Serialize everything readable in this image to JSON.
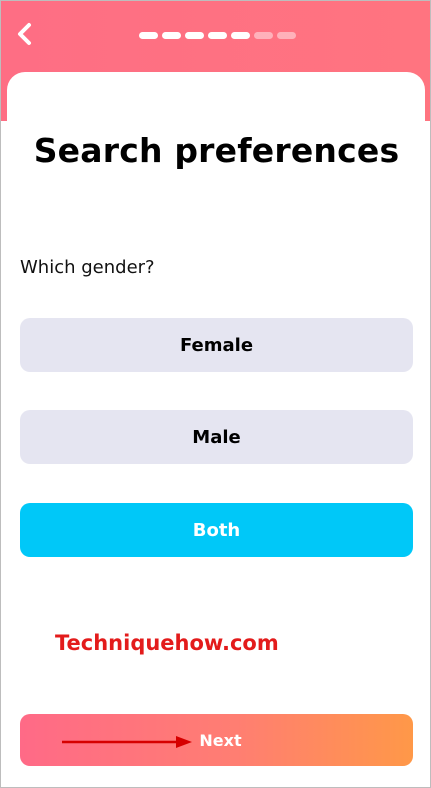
{
  "header": {
    "back_icon": "chevron-left-icon",
    "progress": {
      "total_steps": 7,
      "completed_steps": 5
    },
    "colors": {
      "header_bg": "#fe6e84",
      "active_segment": "#ffffff",
      "inactive_segment": "#ffffff73"
    }
  },
  "main": {
    "title": "Search preferences",
    "question": "Which gender?",
    "options": [
      {
        "label": "Female",
        "selected": false
      },
      {
        "label": "Male",
        "selected": false
      },
      {
        "label": "Both",
        "selected": true
      }
    ],
    "colors": {
      "option_bg": "#e5e5f1",
      "selected_bg": "#00c8f8"
    }
  },
  "watermark": {
    "text": "Techniquehow.com",
    "color": "#e31b1b"
  },
  "footer": {
    "next_label": "Next",
    "arrow_annotation": "red-arrow",
    "colors": {
      "gradient_start": "#ff6a87",
      "gradient_end": "#ff9848"
    }
  }
}
